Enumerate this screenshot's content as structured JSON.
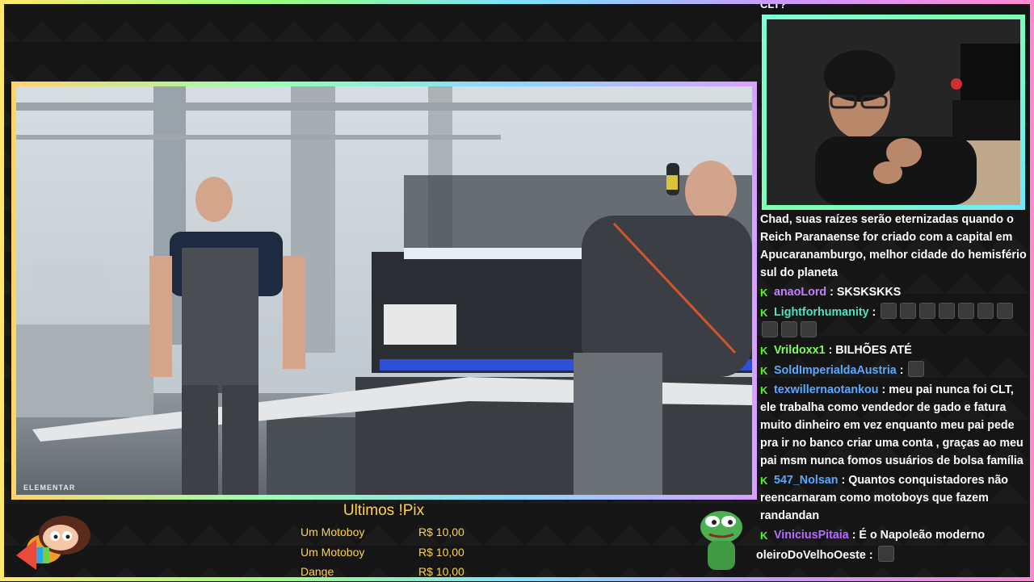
{
  "video": {
    "watermark": "ELEMENTAR"
  },
  "chat": {
    "top_fragment": "CLT?",
    "messages": [
      {
        "user": "",
        "user_color": "#ffffff",
        "text": "Chad, suas raízes serão eternizadas quando o Reich Paranaense for criado com a capital em Apucaranamburgo, melhor cidade do hemisfério sul do planeta",
        "emotes": 0,
        "badge": false
      },
      {
        "user": "anaoLord",
        "user_color": "#c77dff",
        "text": ": SKSKSKKS",
        "emotes": 0,
        "badge": true
      },
      {
        "user": "Lightforhumanity",
        "user_color": "#4fe3c1",
        "text": ":",
        "emotes": 10,
        "badge": true
      },
      {
        "user": "Vrildoxx1",
        "user_color": "#7dff5a",
        "text": ": BILHÕES ATÉ",
        "emotes": 0,
        "badge": true
      },
      {
        "user": "SoldImperialdaAustria",
        "user_color": "#5aa9ff",
        "text": ":",
        "emotes": 1,
        "badge": true
      },
      {
        "user": "texwillernaotankou",
        "user_color": "#5aa9ff",
        "text": ": meu pai nunca foi CLT, ele trabalha como vendedor de gado e fatura muito dinheiro em vez enquanto meu pai pede pra ir no banco criar uma conta , graças ao meu pai msm nunca fomos usuários de bolsa família",
        "emotes": 0,
        "badge": true
      },
      {
        "user": "547_Nolsan",
        "user_color": "#5aa9ff",
        "text": ": Quantos conquistadores não reencarnaram como motoboys que fazem randandan",
        "emotes": 0,
        "badge": true
      },
      {
        "user": "ViniciusPitaia",
        "user_color": "#b66dff",
        "text": ": É o Napoleão moderno",
        "emotes": 0,
        "badge": true
      },
      {
        "user": "oleiroDoVelhoOeste",
        "user_color": "#ffffff",
        "text": ":",
        "emotes": 1,
        "badge": false
      }
    ]
  },
  "pix": {
    "title": "Ultimos !Pix",
    "entries": [
      {
        "name": "Um Motoboy",
        "amount": "R$ 10,00"
      },
      {
        "name": "Um Motoboy",
        "amount": "R$ 10,00"
      },
      {
        "name": "Dange",
        "amount": "R$ 10,00"
      }
    ]
  },
  "colors": {
    "accent_gold": "#ffd24a",
    "kick_green": "#53fc18",
    "background": "#151515"
  },
  "icons": {
    "badge": "kick-badge-icon",
    "left_mascot": "cartoon-mascot-icon",
    "right_mascot": "pepe-frog-icon"
  }
}
